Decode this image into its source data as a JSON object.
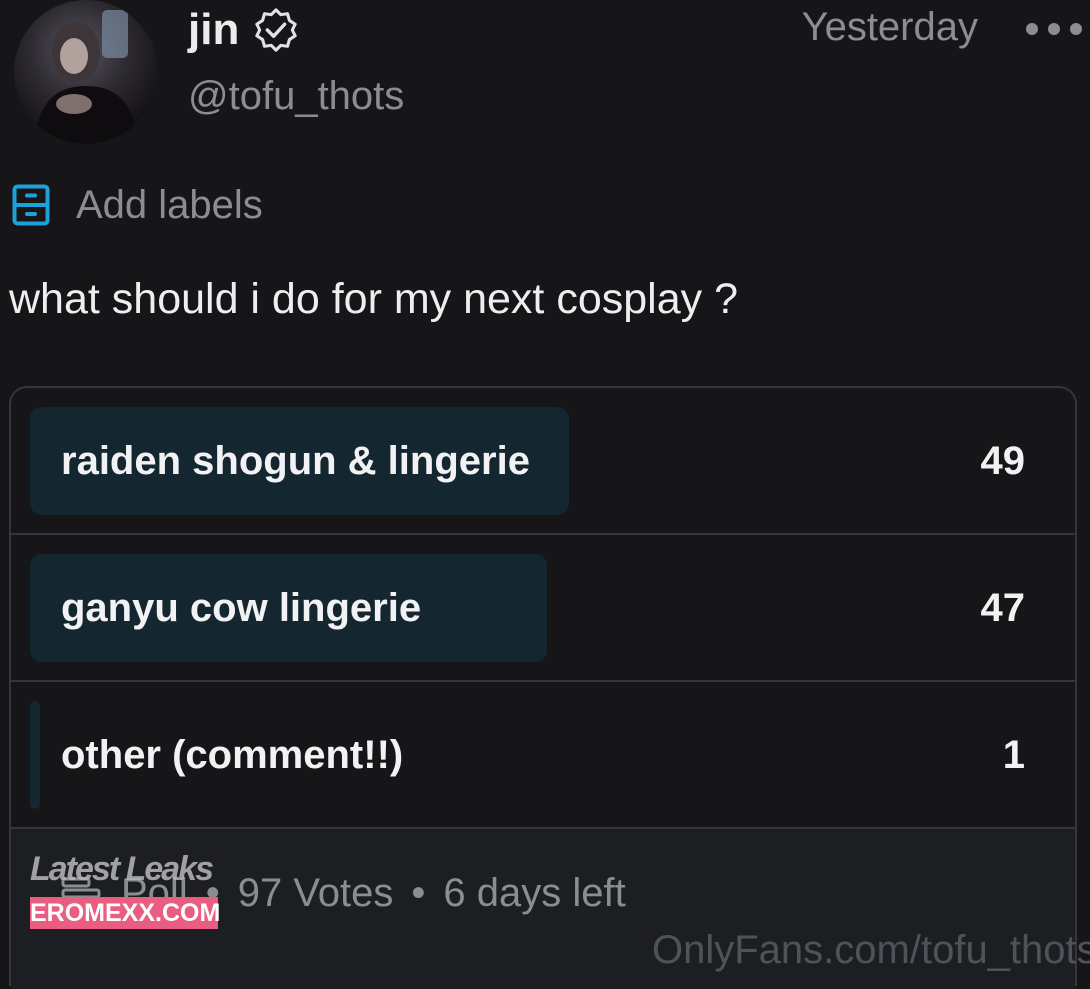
{
  "post": {
    "author": {
      "display_name": "jin",
      "handle": "@tofu_thots",
      "verified": true,
      "avatar": "profile-photo"
    },
    "timestamp": "Yesterday",
    "more_icon": "ellipsis-horizontal-icon",
    "labels": {
      "icon": "label-icon",
      "text": "Add labels",
      "icon_color": "#1da1d9"
    },
    "text": "what should i do for my next cosplay ?"
  },
  "poll": {
    "options": [
      {
        "label": "raiden shogun & lingerie",
        "count": "49",
        "share": 0.505
      },
      {
        "label": "ganyu cow lingerie",
        "count": "47",
        "share": 0.485
      },
      {
        "label": "other (comment!!)",
        "count": "1",
        "share": 0.01
      }
    ],
    "type_label": "Poll",
    "votes": "97 Votes",
    "separator": "•",
    "time_left": "6 days left",
    "fill_color": "#142730"
  },
  "watermarks": {
    "top": "Latest Leaks",
    "badge": "EROMEXX.COM",
    "url": "OnlyFans.com/tofu_thots"
  }
}
